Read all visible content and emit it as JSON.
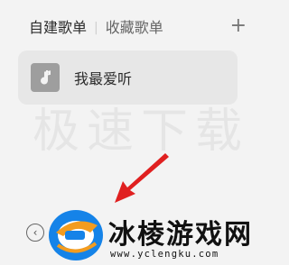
{
  "tabs": {
    "active": "自建歌单",
    "separator": "|",
    "other": "收藏歌单",
    "add_icon": "+"
  },
  "playlists": [
    {
      "name": "我最爱听",
      "icon": "music-note-icon"
    }
  ],
  "watermark": {
    "background_text": "极速下载",
    "overlay_title": "冰棱游戏网",
    "overlay_url": "www.yclengku.com"
  },
  "controls": {
    "collapse_icon": "‹"
  },
  "colors": {
    "arrow": "#e02020",
    "logo_blue": "#1583e8",
    "logo_orange": "#f39c1f"
  }
}
